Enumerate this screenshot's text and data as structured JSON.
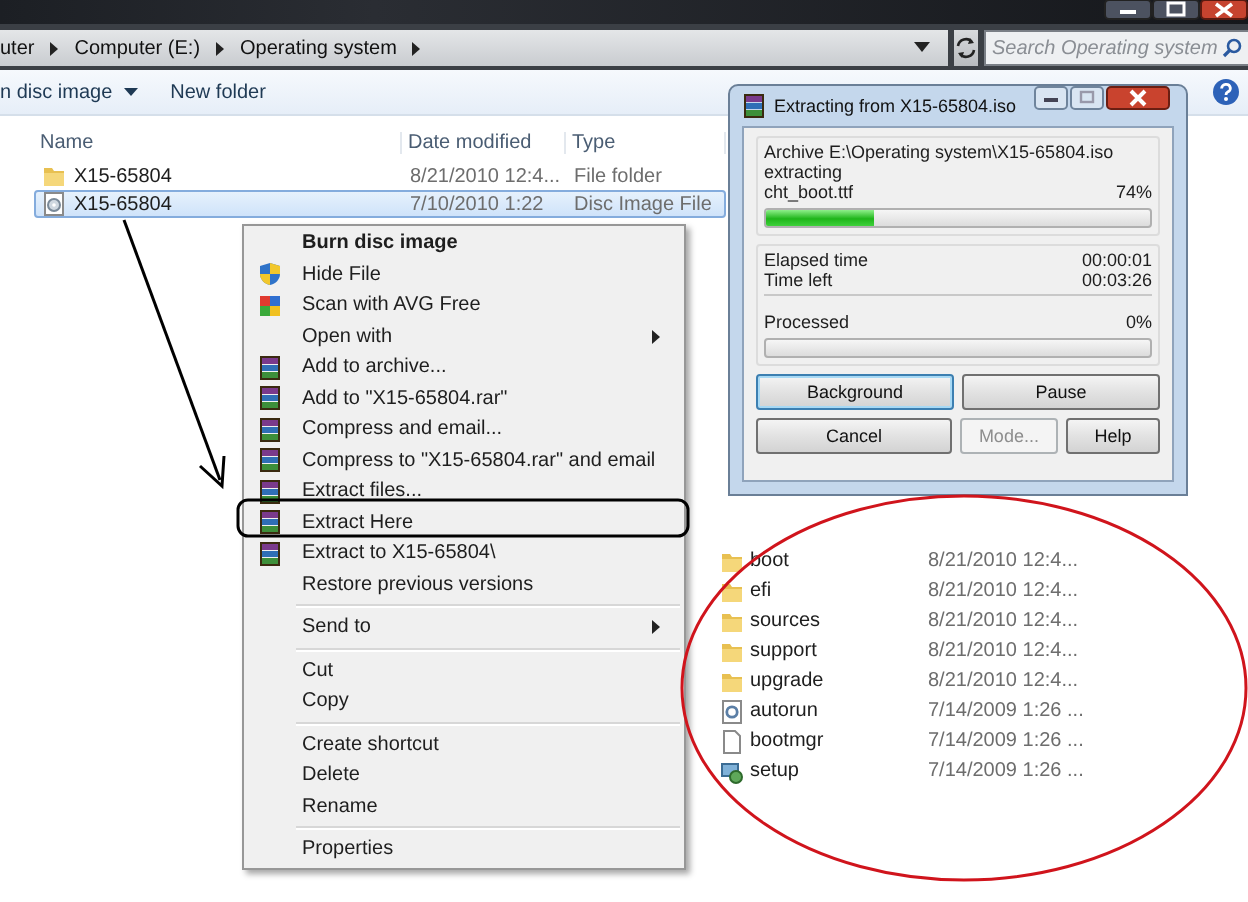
{
  "address_bar": {
    "crumbs": [
      "uter",
      "Computer (E:)",
      "Operating system"
    ],
    "search": {
      "placeholder": "Search Operating system"
    }
  },
  "toolbar": {
    "items": [
      {
        "label": "n disc image",
        "kind": "dropdown"
      },
      {
        "label": "New folder",
        "kind": "button"
      }
    ]
  },
  "file_list": {
    "columns": [
      "Name",
      "Date modified",
      "Type"
    ],
    "rows": [
      {
        "name": "X15-65804",
        "date": "8/21/2010 12:4...",
        "type": "File folder",
        "kind": "folder",
        "selected": false
      },
      {
        "name": "X15-65804",
        "date": "7/10/2010 1:22",
        "type": "Disc Image File",
        "kind": "disc",
        "selected": true
      }
    ]
  },
  "context_menu": {
    "groups": [
      [
        {
          "label": "Burn disc image",
          "kind": "plain",
          "default": true,
          "submenu": false
        },
        {
          "label": "Hide File",
          "kind": "shield",
          "default": false,
          "submenu": false
        },
        {
          "label": "Scan with AVG Free",
          "kind": "scanner",
          "default": false,
          "submenu": false
        },
        {
          "label": "Open with",
          "kind": "plain",
          "default": false,
          "submenu": true
        },
        {
          "label": "Add to archive...",
          "kind": "archive",
          "default": false,
          "submenu": false
        },
        {
          "label": "Add to \"X15-65804.rar\"",
          "kind": "archive",
          "default": false,
          "submenu": false
        },
        {
          "label": "Compress and email...",
          "kind": "archive",
          "default": false,
          "submenu": false
        },
        {
          "label": "Compress to \"X15-65804.rar\" and email",
          "kind": "archive",
          "default": false,
          "submenu": false
        },
        {
          "label": "Extract files...",
          "kind": "archive",
          "default": false,
          "submenu": false
        },
        {
          "label": "Extract Here",
          "kind": "archive",
          "default": false,
          "submenu": false
        },
        {
          "label": "Extract to X15-65804\\",
          "kind": "archive",
          "default": false,
          "submenu": false
        },
        {
          "label": "Restore previous versions",
          "kind": "plain",
          "default": false,
          "submenu": false
        }
      ],
      [
        {
          "label": "Send to",
          "kind": "plain",
          "default": false,
          "submenu": true
        }
      ],
      [
        {
          "label": "Cut",
          "kind": "plain",
          "default": false,
          "submenu": false
        },
        {
          "label": "Copy",
          "kind": "plain",
          "default": false,
          "submenu": false
        }
      ],
      [
        {
          "label": "Create shortcut",
          "kind": "plain",
          "default": false,
          "submenu": false
        },
        {
          "label": "Delete",
          "kind": "plain",
          "default": false,
          "submenu": false
        },
        {
          "label": "Rename",
          "kind": "plain",
          "default": false,
          "submenu": false
        }
      ],
      [
        {
          "label": "Properties",
          "kind": "plain",
          "default": false,
          "submenu": false
        }
      ]
    ]
  },
  "dialog": {
    "title": "Extracting from X15-65804.iso",
    "archive": "Archive E:\\Operating system\\X15-65804.iso",
    "action": "extracting",
    "file": "cht_boot.ttf",
    "file_percent": "74%",
    "file_progress": {
      "level": 0.28
    },
    "times": [
      {
        "label": "Elapsed time",
        "value": "00:00:01"
      },
      {
        "label": "Time left",
        "value": "00:03:26"
      }
    ],
    "processed": {
      "label": "Processed",
      "value": "0%",
      "level": 0
    },
    "buttons": [
      [
        {
          "label": "Background",
          "disabled": false,
          "focused": true
        },
        {
          "label": "Pause",
          "disabled": false,
          "focused": false
        }
      ],
      [
        {
          "label": "Cancel",
          "disabled": false,
          "focused": false
        },
        {
          "label": "Mode...",
          "disabled": true,
          "focused": false
        },
        {
          "label": "Help",
          "disabled": false,
          "focused": false
        }
      ]
    ]
  },
  "extracted_files": [
    {
      "name": "boot",
      "date": "8/21/2010 12:4...",
      "kind": "folder"
    },
    {
      "name": "efi",
      "date": "8/21/2010 12:4...",
      "kind": "folder"
    },
    {
      "name": "sources",
      "date": "8/21/2010 12:4...",
      "kind": "folder"
    },
    {
      "name": "support",
      "date": "8/21/2010 12:4...",
      "kind": "folder"
    },
    {
      "name": "upgrade",
      "date": "8/21/2010 12:4...",
      "kind": "folder"
    },
    {
      "name": "autorun",
      "date": "7/14/2009 1:26 ...",
      "kind": "config"
    },
    {
      "name": "bootmgr",
      "date": "7/14/2009 1:26 ...",
      "kind": "file"
    },
    {
      "name": "setup",
      "date": "7/14/2009 1:26 ...",
      "kind": "setup"
    }
  ]
}
